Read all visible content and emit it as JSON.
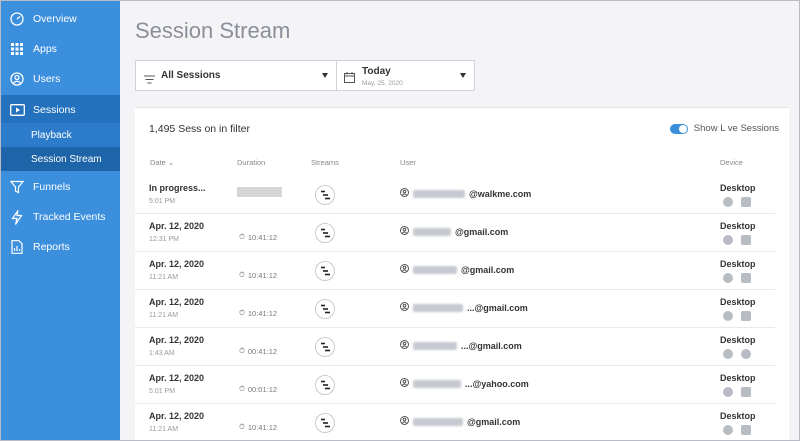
{
  "sidebar": {
    "items": [
      {
        "label": "Overview",
        "icon": "dashboard-icon"
      },
      {
        "label": "Apps",
        "icon": "grid-icon"
      },
      {
        "label": "Users",
        "icon": "user-icon"
      },
      {
        "label": "Sessions",
        "icon": "video-icon"
      },
      {
        "label": "Funnels",
        "icon": "funnel-icon"
      },
      {
        "label": "Tracked Events",
        "icon": "lightning-icon"
      },
      {
        "label": "Reports",
        "icon": "report-icon"
      }
    ],
    "subitems": [
      {
        "label": "Playback"
      },
      {
        "label": "Session Stream"
      }
    ]
  },
  "header": {
    "title": "Session Stream",
    "filter_sessions": "All Sessions",
    "filter_date": "Today",
    "filter_date_sub": "May, 25, 2020"
  },
  "panel": {
    "count": "1,495 Sess on in filter",
    "live_label": "Show L ve Sessions",
    "columns": {
      "date": "Date",
      "duration": "Duration",
      "streams": "Streams",
      "user": "User",
      "device": "Device"
    },
    "rows": [
      {
        "date": "In progress...",
        "time": "5:01 PM",
        "duration": "",
        "user": "@walkme.com",
        "device": "Desktop"
      },
      {
        "date": "Apr. 12, 2020",
        "time": "12:31 PM",
        "duration": "10:41:12",
        "user": "@gmail.com",
        "device": "Desktop"
      },
      {
        "date": "Apr. 12, 2020",
        "time": "11:21 AM",
        "duration": "10:41:12",
        "user": "@gmail.com",
        "device": "Desktop"
      },
      {
        "date": "Apr. 12, 2020",
        "time": "11:21 AM",
        "duration": "10:41:12",
        "user": "...@gmail.com",
        "device": "Desktop"
      },
      {
        "date": "Apr. 12, 2020",
        "time": "1:43 AM",
        "duration": "00:41:12",
        "user": "...@gmail.com",
        "device": "Desktop"
      },
      {
        "date": "Apr. 12, 2020",
        "time": "5:01 PM",
        "duration": "00:01:12",
        "user": "...@yahoo.com",
        "device": "Desktop"
      },
      {
        "date": "Apr. 12, 2020",
        "time": "11:21 AM",
        "duration": "10:41:12",
        "user": "@gmail.com",
        "device": "Desktop"
      }
    ]
  },
  "colors": {
    "sidebar": "#3b8fdd",
    "sidebar_active": "#2472bd",
    "accent": "#3b8fdd"
  }
}
